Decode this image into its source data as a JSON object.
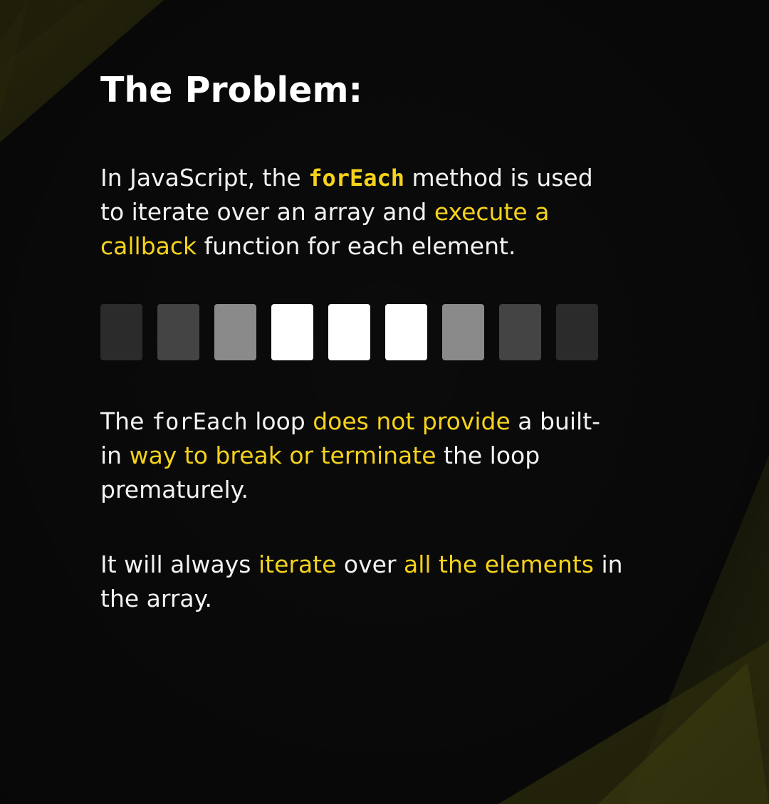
{
  "title": "The Problem:",
  "paragraph1": {
    "t1": "In JavaScript, the ",
    "code": "forEach",
    "t2": " method is used",
    "t3": "to iterate over an array and ",
    "hl1": "execute a",
    "hl2": "callback",
    "t4": " function for each element."
  },
  "array_visual": {
    "cells": [
      {
        "color": "#2b2b2b"
      },
      {
        "color": "#444444"
      },
      {
        "color": "#8a8a8a"
      },
      {
        "color": "#ffffff"
      },
      {
        "color": "#ffffff"
      },
      {
        "color": "#ffffff"
      },
      {
        "color": "#8a8a8a"
      },
      {
        "color": "#444444"
      },
      {
        "color": "#2b2b2b"
      }
    ]
  },
  "paragraph2": {
    "t1": "The ",
    "code": "forEach",
    "t2": " loop ",
    "hl1": "does not provide",
    "t3": " a built-",
    "t4": "in ",
    "hl2": "way to break or terminate",
    "t5": " the loop",
    "t6": "prematurely."
  },
  "paragraph3": {
    "t1": "It will always ",
    "hl1": "iterate",
    "t2": " over ",
    "hl2": "all the elements",
    "t3": " in",
    "t4": "the array."
  },
  "colors": {
    "background": "#0b0b0b",
    "accent": "#f5d21c",
    "text": "#f2f2f2",
    "decor": "#3a3a10"
  }
}
